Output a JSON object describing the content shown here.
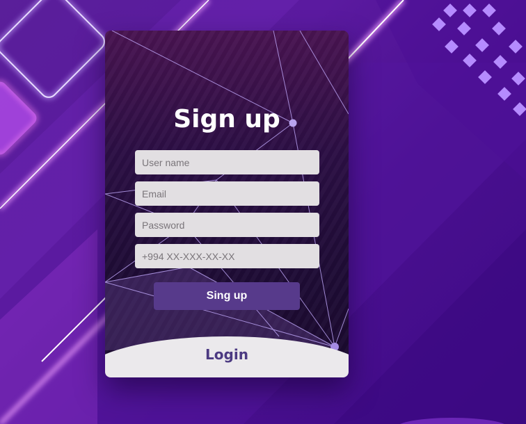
{
  "form": {
    "title": "Sign up",
    "username_placeholder": "User name",
    "email_placeholder": "Email",
    "password_placeholder": "Password",
    "phone_placeholder": "+994 XX-XXX-XX-XX",
    "submit_label": "Sing up",
    "login_label": "Login"
  },
  "colors": {
    "button": "#573a8b",
    "login_text": "#4c3a82",
    "input_bg": "#e2dfe2"
  }
}
